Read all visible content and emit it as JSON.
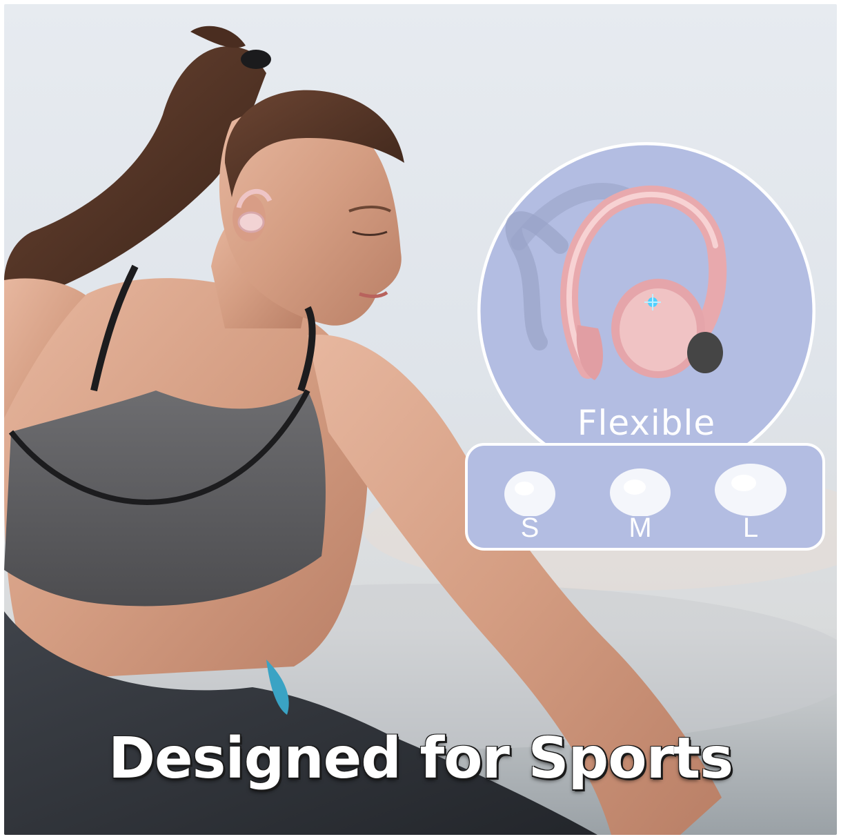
{
  "badge": {
    "label": "Flexible"
  },
  "ear_tips": [
    {
      "size": "S"
    },
    {
      "size": "M"
    },
    {
      "size": "L"
    }
  ],
  "headline": "Designed for Sports",
  "colors": {
    "accent_pink": "#e9aab0",
    "panel_blue": "#b3bde2",
    "sky": "#dfe5ec"
  }
}
